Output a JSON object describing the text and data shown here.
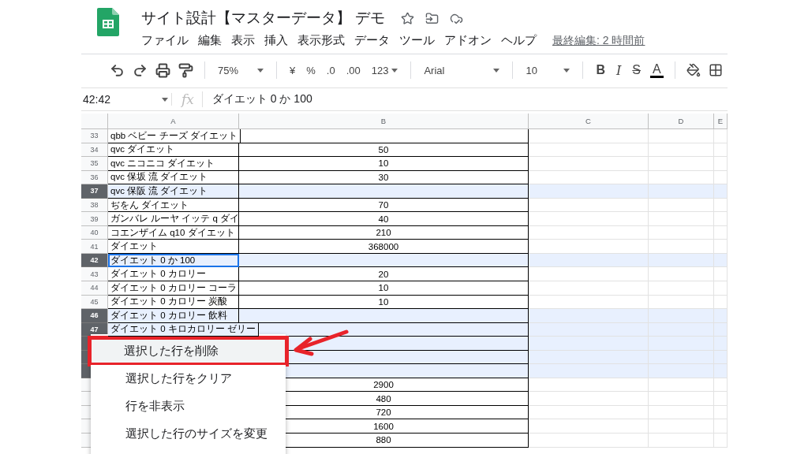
{
  "document": {
    "title": "サイト設計【マスターデータ】 デモ",
    "last_edit": "最終編集: 2 時間前"
  },
  "menu_bar": [
    "ファイル",
    "編集",
    "表示",
    "挿入",
    "表示形式",
    "データ",
    "ツール",
    "アドオン",
    "ヘルプ"
  ],
  "toolbar": {
    "zoom": "75%",
    "currency": "¥",
    "percent": "%",
    "decrease_decimals": ".0",
    "increase_decimals": ".00",
    "more_formats": "123",
    "font": "Arial",
    "font_size": "10",
    "bold": "B",
    "italic": "I",
    "strikethrough": "S",
    "text_color": "A"
  },
  "formula_bar": {
    "cell": "42:42",
    "fx": "fx",
    "value": "ダイエット 0 か 100"
  },
  "columns": [
    "A",
    "B",
    "C",
    "D",
    "E"
  ],
  "rows": [
    {
      "number": "33",
      "a": "qbb ベビー チーズ ダイエット",
      "b": "",
      "selected": false,
      "active": false
    },
    {
      "number": "34",
      "a": "qvc ダイエット",
      "b": "50",
      "selected": false,
      "active": false
    },
    {
      "number": "35",
      "a": "qvc ニコニコ ダイエット",
      "b": "10",
      "selected": false,
      "active": false
    },
    {
      "number": "36",
      "a": "qvc 保坂 流 ダイエット",
      "b": "30",
      "selected": false,
      "active": false
    },
    {
      "number": "37",
      "a": "qvc 保阪 流 ダイエット",
      "b": "",
      "selected": true,
      "active": false
    },
    {
      "number": "38",
      "a": "ぢをん ダイエット",
      "b": "70",
      "selected": false,
      "active": false
    },
    {
      "number": "39",
      "a": "ガンバレ ルーヤ イッテ q ダイ",
      "b": "40",
      "selected": false,
      "active": false
    },
    {
      "number": "40",
      "a": "コエンザイム q10 ダイエット",
      "b": "210",
      "selected": false,
      "active": false
    },
    {
      "number": "41",
      "a": "ダイエット",
      "b": "368000",
      "selected": false,
      "active": false
    },
    {
      "number": "42",
      "a": "ダイエット 0 か 100",
      "b": "",
      "selected": true,
      "active": true
    },
    {
      "number": "43",
      "a": "ダイエット 0 カロリー",
      "b": "20",
      "selected": false,
      "active": false
    },
    {
      "number": "44",
      "a": "ダイエット 0 カロリー コーラ",
      "b": "10",
      "selected": false,
      "active": false
    },
    {
      "number": "45",
      "a": "ダイエット 0 カロリー 炭酸",
      "b": "10",
      "selected": false,
      "active": false
    },
    {
      "number": "46",
      "a": "ダイエット 0 カロリー 飲料",
      "b": "",
      "selected": true,
      "active": false
    },
    {
      "number": "47",
      "a": "ダイエット 0 キロカロリー ゼリー",
      "b": "",
      "selected": true,
      "active": false
    },
    {
      "b": "",
      "selected": true
    },
    {
      "b": "",
      "selected": true
    },
    {
      "b": "",
      "selected": true
    },
    {
      "b": "2900",
      "selected": false
    },
    {
      "b": "480",
      "selected": false
    },
    {
      "b": "720",
      "selected": false
    },
    {
      "b": "1600",
      "selected": false
    },
    {
      "b": "880",
      "selected": false
    }
  ],
  "context_menu": [
    {
      "label": "選択した行を削除",
      "highlighted": true
    },
    {
      "label": "選択した行をクリア",
      "highlighted": false
    },
    {
      "label": "行を非表示",
      "highlighted": false
    },
    {
      "label": "選択した行のサイズを変更",
      "highlighted": false
    }
  ]
}
